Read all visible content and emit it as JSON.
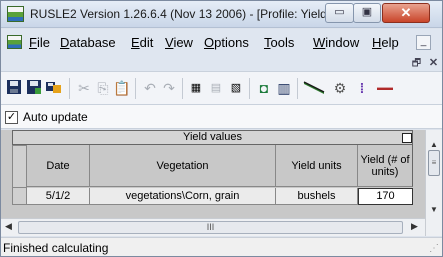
{
  "window": {
    "title": "RUSLE2 Version 1.26.6.4 (Nov 13 2006) - [Profile: Yield...",
    "minimize_glyph": "▭",
    "maximize_glyph": "▣",
    "close_glyph": "✕"
  },
  "menu": {
    "items": [
      "File",
      "Database",
      "Edit",
      "View",
      "Options",
      "Tools",
      "Window",
      "Help"
    ],
    "mdi_min": "_",
    "mdi_restore": "🗗",
    "mdi_close": "✕"
  },
  "toolbar": {
    "buttons": [
      "save-icon",
      "save-all-icon",
      "open-template-icon",
      "cut-icon",
      "copy-icon",
      "paste-icon",
      "undo-icon",
      "redo-icon",
      "calculator-icon",
      "list-icon",
      "compare-icon",
      "view-icon",
      "table-icon",
      "slope-icon",
      "operation-icon",
      "info-icon",
      "logo-icon"
    ]
  },
  "auto_update": {
    "label": "Auto update",
    "checked": true
  },
  "grid": {
    "title": "Yield values",
    "headers": {
      "date": "Date",
      "vegetation": "Vegetation",
      "yield_units": "Yield units",
      "yield_num": "Yield (# of units)"
    },
    "row": {
      "date": "5/1/2",
      "vegetation": "vegetations\\Corn, grain",
      "yield_units": "bushels",
      "yield_num": "170"
    }
  },
  "scroll": {
    "hthumb_glyph": "III",
    "vthumb_glyph": "≡",
    "left": "◀",
    "right": "▶",
    "up": "▲",
    "down": "▼"
  },
  "status": {
    "text": "Finished calculating"
  }
}
